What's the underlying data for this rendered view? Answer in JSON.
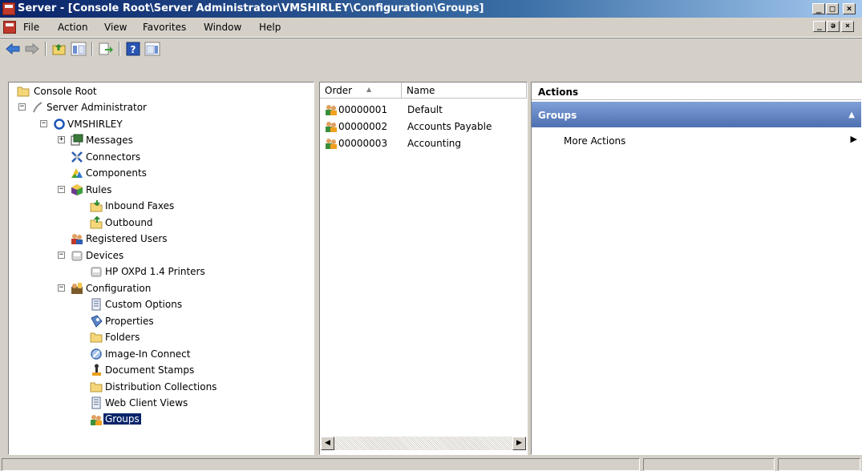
{
  "window": {
    "title": "Server - [Console Root\\Server Administrator\\VMSHIRLEY\\Configuration\\Groups]",
    "min_glyph": "_",
    "max_glyph": "□",
    "close_glyph": "×",
    "restore_glyph": "ǝ"
  },
  "menu": {
    "items": [
      "File",
      "Action",
      "View",
      "Favorites",
      "Window",
      "Help"
    ]
  },
  "tree": {
    "root": "Console Root",
    "server_admin": "Server Administrator",
    "machine": "VMSHIRLEY",
    "messages": "Messages",
    "connectors": "Connectors",
    "components": "Components",
    "rules": "Rules",
    "inbound": "Inbound Faxes",
    "outbound": "Outbound",
    "registered_users": "Registered Users",
    "devices": "Devices",
    "hp_printers": "HP OXPd 1.4 Printers",
    "configuration": "Configuration",
    "custom_options": "Custom Options",
    "properties": "Properties",
    "folders": "Folders",
    "image_in": "Image-In Connect",
    "doc_stamps": "Document Stamps",
    "dist_collections": "Distribution Collections",
    "web_client_views": "Web Client Views",
    "groups": "Groups",
    "expand_minus": "−",
    "expand_plus": "+"
  },
  "list": {
    "columns": [
      "Order",
      "Name"
    ],
    "sort_glyph": "▲",
    "rows": [
      {
        "order": "00000001",
        "name": "Default"
      },
      {
        "order": "00000002",
        "name": "Accounts Payable"
      },
      {
        "order": "00000003",
        "name": "Accounting"
      }
    ],
    "scroll_left": "◀",
    "scroll_right": "▶"
  },
  "actions": {
    "header": "Actions",
    "section": "Groups",
    "collapse_glyph": "▲",
    "more": "More Actions",
    "more_arrow": "▶"
  },
  "colors": {
    "selection": "#0a246a",
    "actions_section": "#4e6fb0"
  }
}
